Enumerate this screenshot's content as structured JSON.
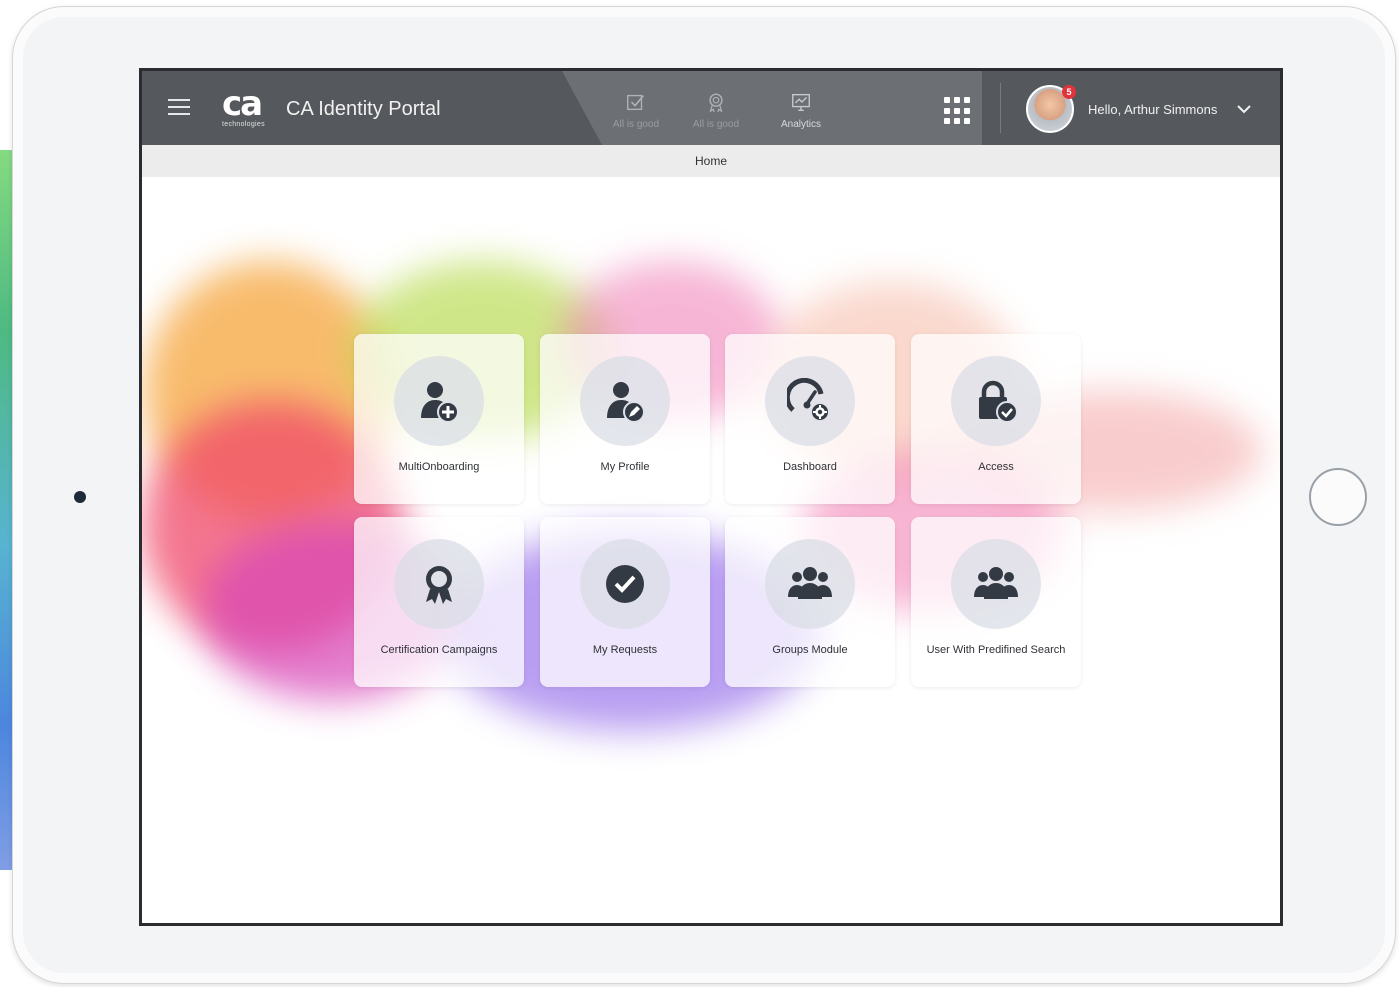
{
  "app": {
    "title": "CA Identity Portal",
    "logo_mark": "ca",
    "logo_sub": "technologies"
  },
  "nav": [
    {
      "label": "All is good",
      "icon": "checkbox-icon"
    },
    {
      "label": "All is good",
      "icon": "badge-icon"
    },
    {
      "label": "Analytics",
      "icon": "analytics-icon"
    }
  ],
  "user": {
    "greeting": "Hello, Arthur Simmons",
    "notification_count": "5"
  },
  "breadcrumb": {
    "current": "Home"
  },
  "tiles": [
    {
      "label": "MultiOnboarding",
      "icon": "user-add-icon"
    },
    {
      "label": "My Profile",
      "icon": "user-edit-icon"
    },
    {
      "label": "Dashboard",
      "icon": "gauge-settings-icon"
    },
    {
      "label": "Access",
      "icon": "lock-check-icon"
    },
    {
      "label": "Certification Campaigns",
      "icon": "award-icon"
    },
    {
      "label": "My Requests",
      "icon": "check-circle-icon"
    },
    {
      "label": "Groups Module",
      "icon": "group-icon"
    },
    {
      "label": "User With Predifined Search",
      "icon": "group-search-icon"
    }
  ],
  "colors": {
    "topbar": "#55585d",
    "icon": "#333a44",
    "badge": "#e0343a"
  }
}
